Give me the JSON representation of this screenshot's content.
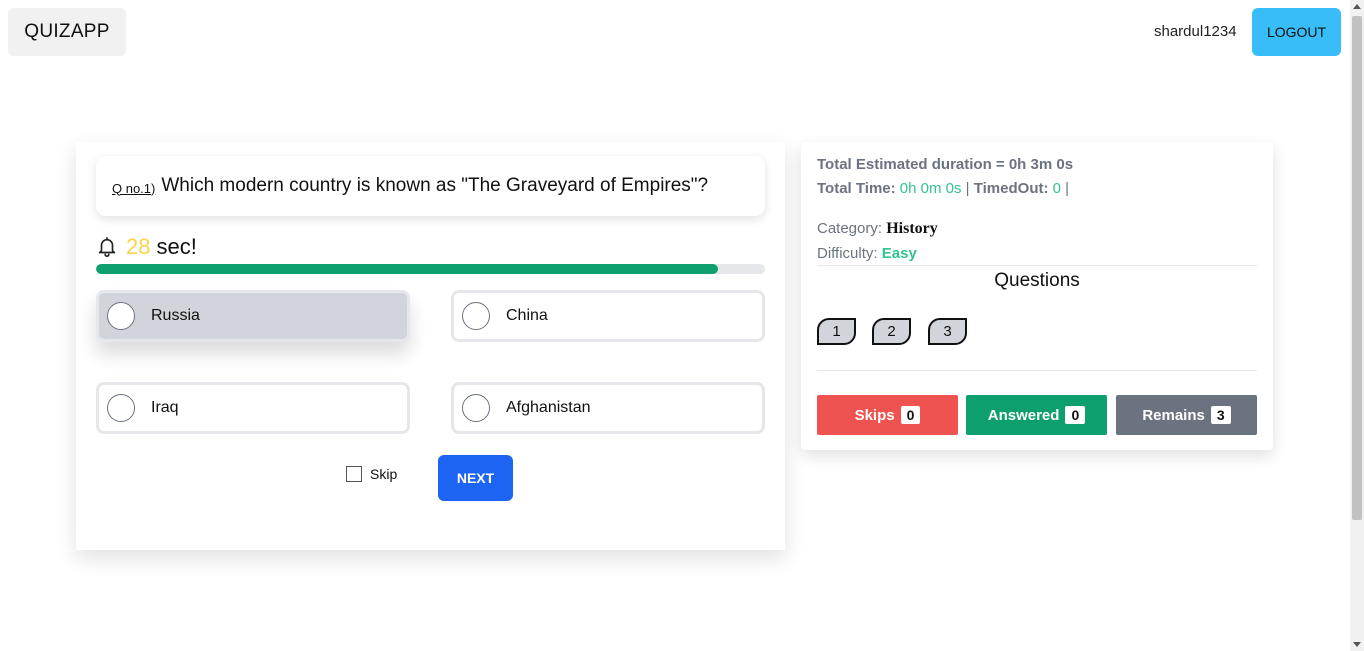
{
  "header": {
    "brand": "QUIZAPP",
    "username": "shardul1234",
    "logout_label": "LOGOUT",
    "accent_color": "#38bdf8"
  },
  "question": {
    "number_label": "Q no.1)",
    "text": "Which modern country is known as \"The Graveyard of Empires\"?"
  },
  "timer": {
    "seconds": "28",
    "suffix": "sec!",
    "progress_percent": 93,
    "icon": "bell-icon"
  },
  "options": [
    {
      "label": "Russia",
      "selected": true
    },
    {
      "label": "China",
      "selected": false
    },
    {
      "label": "Iraq",
      "selected": false
    },
    {
      "label": "Afghanistan",
      "selected": false
    }
  ],
  "controls": {
    "skip_label": "Skip",
    "skip_checked": false,
    "next_label": "NEXT"
  },
  "info": {
    "estimated_label": "Total Estimated duration = 0h 3m 0s",
    "total_time_label": "Total Time:",
    "total_time_value": "0h 0m 0s",
    "sep1": "|",
    "timedout_label": "TimedOut:",
    "timedout_value": "0",
    "sep2": "|",
    "category_label": "Category:",
    "category_value": "History",
    "difficulty_label": "Difficulty:",
    "difficulty_value": "Easy",
    "questions_title": "Questions",
    "question_buttons": [
      "1",
      "2",
      "3"
    ]
  },
  "stats": {
    "skips_label": "Skips",
    "skips_count": "0",
    "skips_color": "#ef5350",
    "answered_label": "Answered",
    "answered_count": "0",
    "answered_color": "#0e9f6e",
    "remains_label": "Remains",
    "remains_count": "3",
    "remains_color": "#6b7280"
  }
}
